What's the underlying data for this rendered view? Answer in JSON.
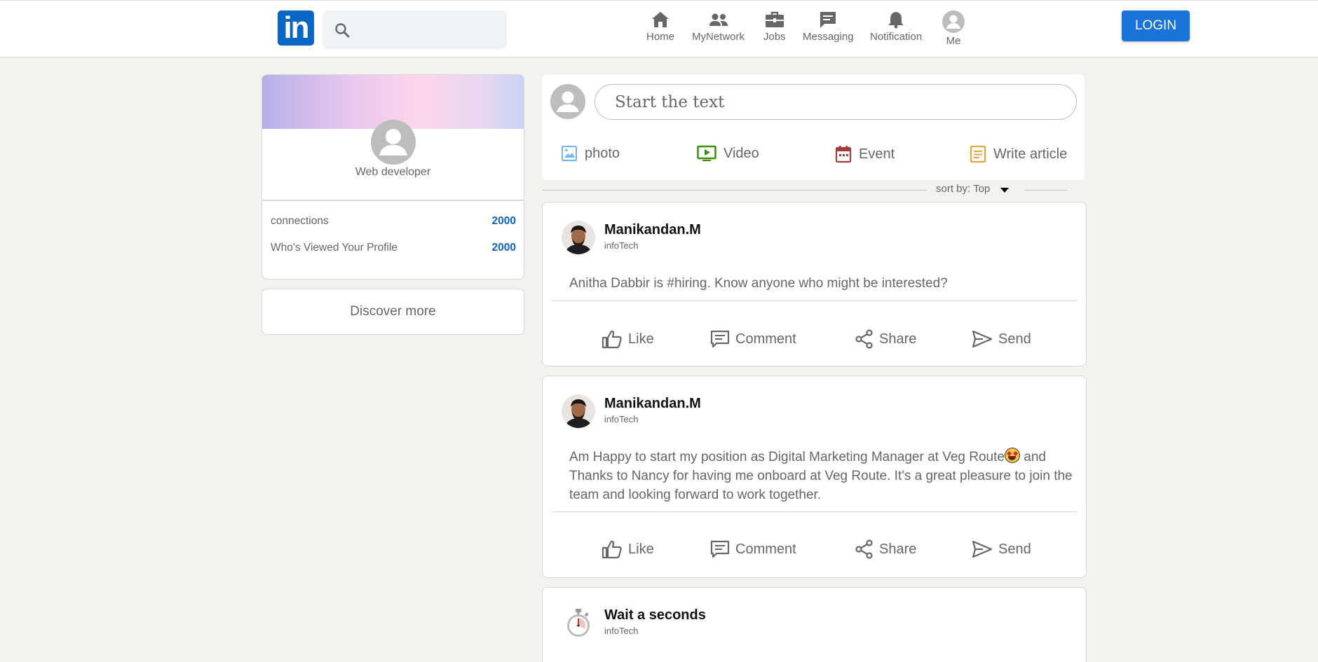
{
  "header": {
    "logo_text": "in",
    "search_placeholder": "",
    "nav": [
      {
        "label": "Home",
        "icon": "home-icon"
      },
      {
        "label": "MyNetwork",
        "icon": "network-icon"
      },
      {
        "label": "Jobs",
        "icon": "briefcase-icon"
      },
      {
        "label": "Messaging",
        "icon": "message-icon"
      },
      {
        "label": "Notification",
        "icon": "bell-icon"
      },
      {
        "label": "Me",
        "icon": "user-avatar-icon"
      }
    ],
    "login_label": "LOGIN"
  },
  "profile": {
    "role": "Web developer",
    "stats": [
      {
        "label": "connections",
        "value": "2000"
      },
      {
        "label": "Who's Viewed Your Profile",
        "value": "2000"
      }
    ],
    "discover_label": "Discover more"
  },
  "composer": {
    "placeholder": "Start the text",
    "tools": [
      {
        "label": "photo",
        "icon": "photo-icon",
        "color": "#70b5f9"
      },
      {
        "label": "Video",
        "icon": "video-icon",
        "color": "#378f0a"
      },
      {
        "label": "Event",
        "icon": "calendar-icon",
        "color": "#a33c3c"
      },
      {
        "label": "Write article",
        "icon": "article-icon",
        "color": "#e7a33e"
      }
    ]
  },
  "sort": {
    "label": "sort by: Top"
  },
  "posts": [
    {
      "author": "Manikandan.M",
      "company": "infoTech",
      "text": "Anitha Dabbir is #hiring. Know anyone who might be interested?"
    },
    {
      "author": "Manikandan.M",
      "company": "infoTech",
      "text_part1": "Am Happy to start my position as Digital Marketing Manager at Veg Route",
      "text_part2": " and Thanks to Nancy for having me onboard at Veg Route. It's a great pleasure to join the team and looking forward to work together."
    },
    {
      "author": "Wait a seconds",
      "company": "infoTech"
    }
  ],
  "actions": [
    "Like",
    "Comment",
    "Share",
    "Send"
  ],
  "colors": {
    "brand": "#0a66c2",
    "login": "#1a73d9",
    "background": "#f3f2ef"
  }
}
